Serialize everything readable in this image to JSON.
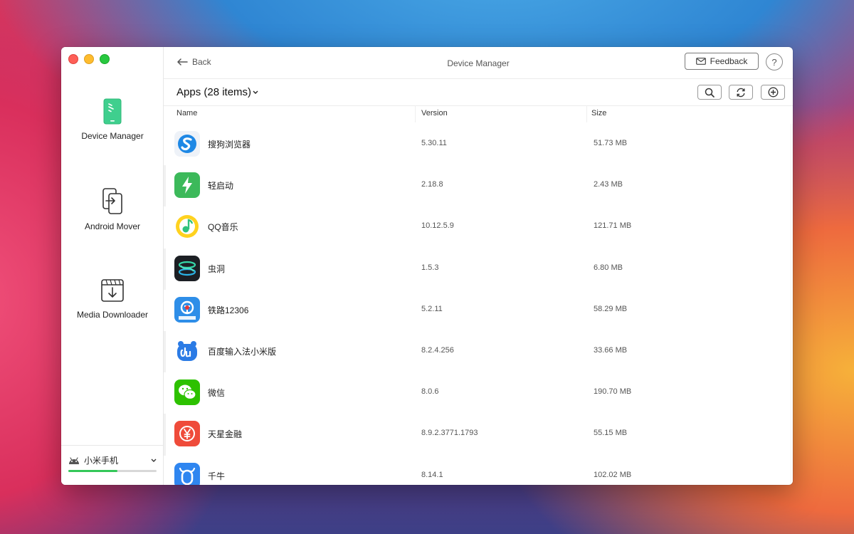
{
  "window": {
    "title": "Device Manager"
  },
  "sidebar": {
    "items": [
      {
        "label": "Device Manager",
        "icon": "phone-icon"
      },
      {
        "label": "Android Mover",
        "icon": "transfer-icon"
      },
      {
        "label": "Media Downloader",
        "icon": "download-icon"
      }
    ],
    "device": {
      "name": "小米手机",
      "storage_used_fraction": 0.56,
      "accent": "#34c759"
    }
  },
  "topbar": {
    "back_label": "Back",
    "feedback_label": "Feedback",
    "help_label": "?"
  },
  "list": {
    "title": "Apps (28 items)",
    "columns": {
      "name": "Name",
      "version": "Version",
      "size": "Size"
    },
    "apps": [
      {
        "name": "搜狗浏览器",
        "version": "5.30.11",
        "size": "51.73 MB",
        "icon": "sogou-browser-icon"
      },
      {
        "name": "轻启动",
        "version": "2.18.8",
        "size": "2.43 MB",
        "icon": "lightning-icon"
      },
      {
        "name": "QQ音乐",
        "version": "10.12.5.9",
        "size": "121.71 MB",
        "icon": "qq-music-icon"
      },
      {
        "name": "虫洞",
        "version": "1.5.3",
        "size": "6.80 MB",
        "icon": "wormhole-icon"
      },
      {
        "name": "铁路12306",
        "version": "5.2.11",
        "size": "58.29 MB",
        "icon": "railway-icon"
      },
      {
        "name": "百度输入法小米版",
        "version": "8.2.4.256",
        "size": "33.66 MB",
        "icon": "baidu-input-icon"
      },
      {
        "name": "微信",
        "version": "8.0.6",
        "size": "190.70 MB",
        "icon": "wechat-icon"
      },
      {
        "name": "天星金融",
        "version": "8.9.2.3771.1793",
        "size": "55.15 MB",
        "icon": "yuan-icon"
      },
      {
        "name": "千牛",
        "version": "8.14.1",
        "size": "102.02 MB",
        "icon": "qianniu-icon"
      }
    ]
  }
}
